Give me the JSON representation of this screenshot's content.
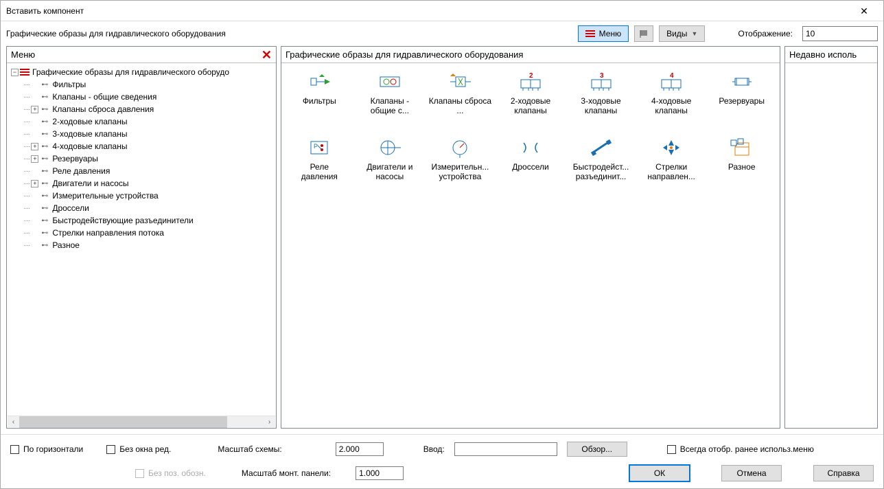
{
  "window": {
    "title": "Вставить компонент"
  },
  "subheader": {
    "subtitle": "Графические образы для гидравлического оборудования",
    "menu_label": "Меню",
    "views_label": "Виды",
    "display_label": "Отображение:",
    "display_value": "10"
  },
  "left_panel": {
    "title": "Меню",
    "root": "Графические образы для гидравлического оборудо",
    "items": [
      {
        "label": "Фильтры",
        "expander": "none"
      },
      {
        "label": "Клапаны - общие сведения",
        "expander": "none"
      },
      {
        "label": "Клапаны сброса давления",
        "expander": "plus"
      },
      {
        "label": "2-ходовые клапаны",
        "expander": "none"
      },
      {
        "label": "3-ходовые клапаны",
        "expander": "none"
      },
      {
        "label": "4-ходовые клапаны",
        "expander": "plus"
      },
      {
        "label": "Резервуары",
        "expander": "plus"
      },
      {
        "label": "Реле давления",
        "expander": "none"
      },
      {
        "label": "Двигатели и насосы",
        "expander": "plus"
      },
      {
        "label": "Измерительные устройства",
        "expander": "none"
      },
      {
        "label": "Дроссели",
        "expander": "none"
      },
      {
        "label": "Быстродействующие разъединители",
        "expander": "none"
      },
      {
        "label": "Стрелки направления потока",
        "expander": "none"
      },
      {
        "label": "Разное",
        "expander": "none"
      }
    ]
  },
  "center_panel": {
    "title": "Графические образы для гидравлического оборудования",
    "items": [
      {
        "label": "Фильтры",
        "icon": "filter-icon"
      },
      {
        "label": "Клапаны - общие с...",
        "icon": "valve-general-icon"
      },
      {
        "label": "Клапаны сброса ...",
        "icon": "valve-relief-icon"
      },
      {
        "label": "2-ходовые клапаны",
        "icon": "valve-2way-icon"
      },
      {
        "label": "3-ходовые клапаны",
        "icon": "valve-3way-icon"
      },
      {
        "label": "4-ходовые клапаны",
        "icon": "valve-4way-icon"
      },
      {
        "label": "Резервуары",
        "icon": "reservoir-icon"
      },
      {
        "label": "Реле давления",
        "icon": "pressure-switch-icon"
      },
      {
        "label": "Двигатели и насосы",
        "icon": "motor-pump-icon"
      },
      {
        "label": "Измерительн... устройства",
        "icon": "gauge-icon"
      },
      {
        "label": "Дроссели",
        "icon": "throttle-icon"
      },
      {
        "label": "Быстродейст... разъединит...",
        "icon": "quick-conn-icon"
      },
      {
        "label": "Стрелки направлен...",
        "icon": "flow-arrow-icon"
      },
      {
        "label": "Разное",
        "icon": "misc-icon"
      }
    ]
  },
  "right_panel": {
    "title": "Недавно исполь"
  },
  "bottom": {
    "horizontal_label": "По горизонтали",
    "noeditwin_label": "Без окна ред.",
    "nopos_label": "Без поз. обозн.",
    "scale_scheme_label": "Масштаб схемы:",
    "scale_scheme_value": "2.000",
    "scale_panel_label": "Масштаб монт. панели:",
    "scale_panel_value": "1.000",
    "input_label": "Ввод:",
    "input_value": "",
    "browse_label": "Обзор...",
    "always_show_label": "Всегда отобр. ранее использ.меню",
    "ok_label": "ОК",
    "cancel_label": "Отмена",
    "help_label": "Справка"
  }
}
